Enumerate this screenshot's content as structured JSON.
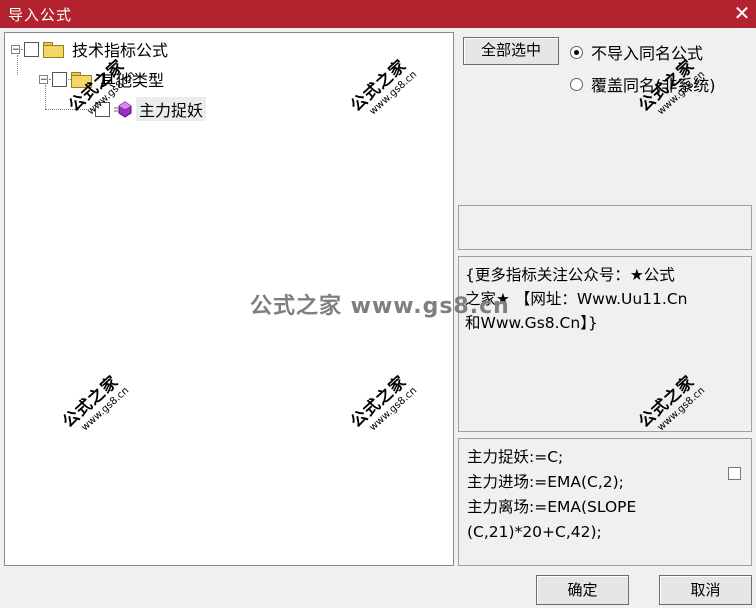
{
  "window": {
    "title": "导入公式",
    "close_glyph": "✕"
  },
  "tree": {
    "root": {
      "label": "技术指标公式",
      "expand_glyph": "−",
      "icon": "folder-icon"
    },
    "category": {
      "label": "其他类型",
      "expand_glyph": "−",
      "icon": "folder-icon"
    },
    "formula": {
      "label": "主力捉妖",
      "icon": "formula-icon",
      "color": "#9b2cc4"
    }
  },
  "controls": {
    "select_all_label": "全部选中",
    "option_skip": "不导入同名公式",
    "option_overwrite": "覆盖同名(非系统)",
    "selected_option": "option_skip"
  },
  "description": {
    "lines": [
      "{更多指标关注公众号：★公式",
      "之家★ 【网址：Www.Uu11.Cn",
      "和Www.Gs8.Cn】}"
    ]
  },
  "code": {
    "lines": [
      "主力捉妖:=C;",
      "主力进场:=EMA(C,2);",
      "主力离场:=EMA(SLOPE",
      "(C,21)*20+C,42);"
    ]
  },
  "footer": {
    "ok_label": "确定",
    "cancel_label": "取消"
  },
  "watermark": {
    "brand": "公式之家",
    "url": "www.gs8.cn",
    "center_text": "公式之家 www.gs8.cn"
  },
  "colors": {
    "title_bar": "#b3232f",
    "folder": "#f2d766"
  }
}
